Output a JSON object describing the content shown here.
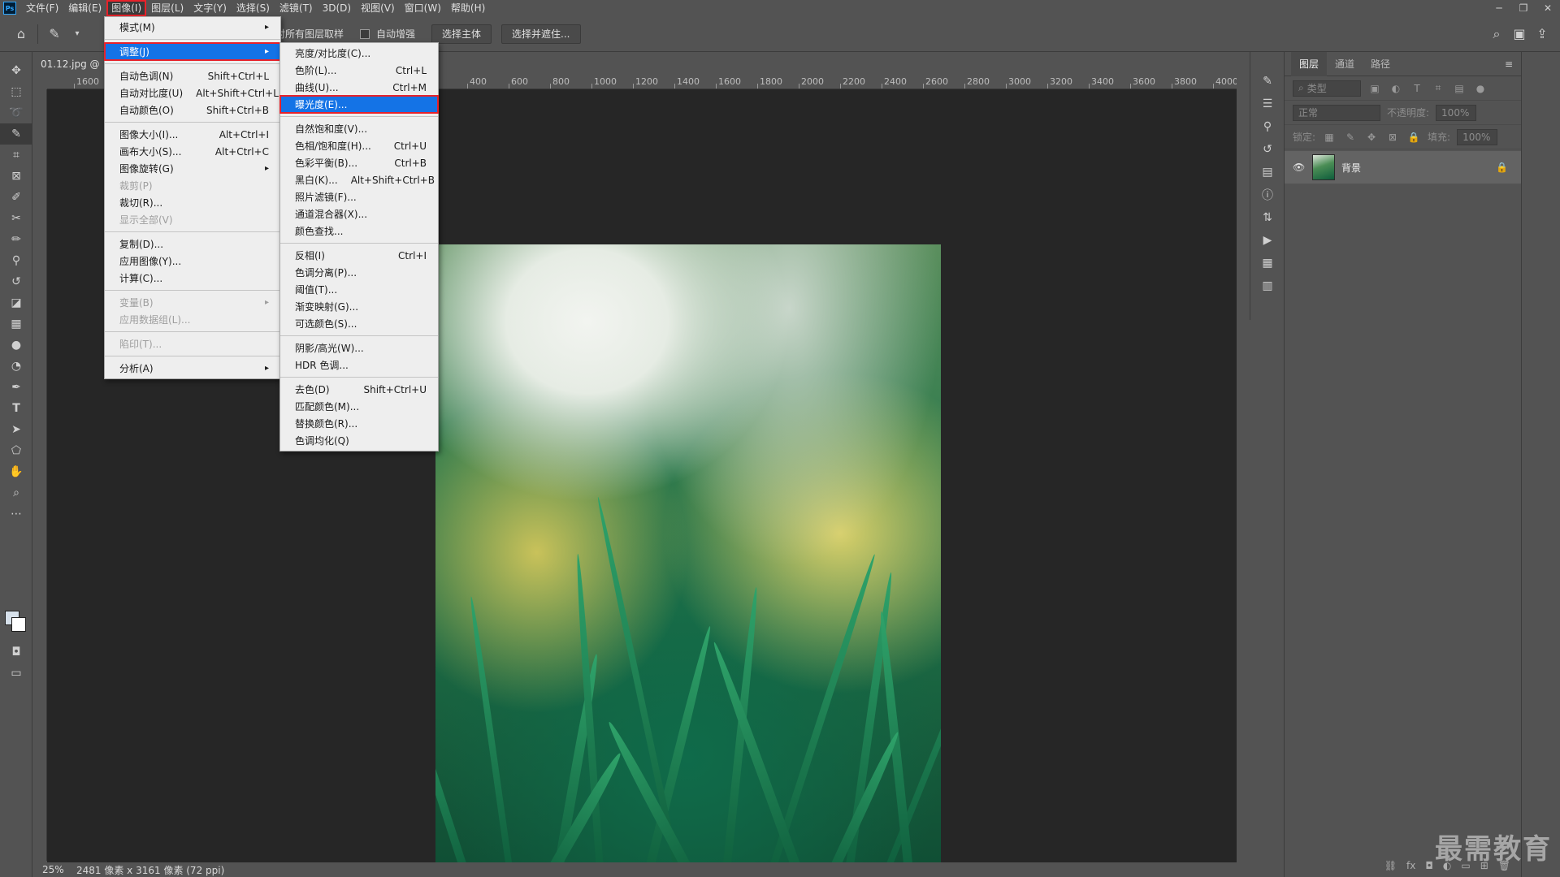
{
  "menubar": {
    "items": [
      "文件(F)",
      "编辑(E)",
      "图像(I)",
      "图层(L)",
      "文字(Y)",
      "选择(S)",
      "滤镜(T)",
      "3D(D)",
      "视图(V)",
      "窗口(W)",
      "帮助(H)"
    ],
    "active": "图像(I)",
    "logo": "Ps"
  },
  "options_bar": {
    "sample_all_layers": "对所有图层取样",
    "auto_enhance": "自动增强",
    "select_subject": "选择主体",
    "select_and_mask": "选择并遮住..."
  },
  "document": {
    "tab_title": "01.12.jpg @",
    "ruler_labels": [
      "1600",
      "400",
      "600",
      "800",
      "1000",
      "1200",
      "1400",
      "1600",
      "1800",
      "2000",
      "2200",
      "2400",
      "2600",
      "2800",
      "3000",
      "3200",
      "3400",
      "3600",
      "3800",
      "4000"
    ]
  },
  "status": {
    "zoom": "25%",
    "doc_info": "2481 像素 x 3161 像素 (72 ppi)"
  },
  "image_menu": [
    {
      "label": "模式(M)",
      "shortcut": "",
      "submenu": true,
      "disabled": false
    },
    {
      "sep": true
    },
    {
      "label": "调整(J)",
      "shortcut": "",
      "submenu": true,
      "disabled": false,
      "highlight": true
    },
    {
      "sep": true
    },
    {
      "label": "自动色调(N)",
      "shortcut": "Shift+Ctrl+L"
    },
    {
      "label": "自动对比度(U)",
      "shortcut": "Alt+Shift+Ctrl+L"
    },
    {
      "label": "自动颜色(O)",
      "shortcut": "Shift+Ctrl+B"
    },
    {
      "sep": true
    },
    {
      "label": "图像大小(I)...",
      "shortcut": "Alt+Ctrl+I"
    },
    {
      "label": "画布大小(S)...",
      "shortcut": "Alt+Ctrl+C"
    },
    {
      "label": "图像旋转(G)",
      "shortcut": "",
      "submenu": true
    },
    {
      "label": "裁剪(P)",
      "shortcut": "",
      "disabled": true
    },
    {
      "label": "裁切(R)...",
      "shortcut": ""
    },
    {
      "label": "显示全部(V)",
      "shortcut": "",
      "disabled": true
    },
    {
      "sep": true
    },
    {
      "label": "复制(D)...",
      "shortcut": ""
    },
    {
      "label": "应用图像(Y)...",
      "shortcut": ""
    },
    {
      "label": "计算(C)...",
      "shortcut": ""
    },
    {
      "sep": true
    },
    {
      "label": "变量(B)",
      "shortcut": "",
      "submenu": true,
      "disabled": true
    },
    {
      "label": "应用数据组(L)...",
      "shortcut": "",
      "disabled": true
    },
    {
      "sep": true
    },
    {
      "label": "陷印(T)...",
      "shortcut": "",
      "disabled": true
    },
    {
      "sep": true
    },
    {
      "label": "分析(A)",
      "shortcut": "",
      "submenu": true
    }
  ],
  "adjust_menu": [
    {
      "label": "亮度/对比度(C)...",
      "shortcut": ""
    },
    {
      "label": "色阶(L)...",
      "shortcut": "Ctrl+L"
    },
    {
      "label": "曲线(U)...",
      "shortcut": "Ctrl+M"
    },
    {
      "label": "曝光度(E)...",
      "shortcut": "",
      "highlight": true
    },
    {
      "sep": true
    },
    {
      "label": "自然饱和度(V)...",
      "shortcut": ""
    },
    {
      "label": "色相/饱和度(H)...",
      "shortcut": "Ctrl+U"
    },
    {
      "label": "色彩平衡(B)...",
      "shortcut": "Ctrl+B"
    },
    {
      "label": "黑白(K)...",
      "shortcut": "Alt+Shift+Ctrl+B"
    },
    {
      "label": "照片滤镜(F)...",
      "shortcut": ""
    },
    {
      "label": "通道混合器(X)...",
      "shortcut": ""
    },
    {
      "label": "颜色查找...",
      "shortcut": ""
    },
    {
      "sep": true
    },
    {
      "label": "反相(I)",
      "shortcut": "Ctrl+I"
    },
    {
      "label": "色调分离(P)...",
      "shortcut": ""
    },
    {
      "label": "阈值(T)...",
      "shortcut": ""
    },
    {
      "label": "渐变映射(G)...",
      "shortcut": ""
    },
    {
      "label": "可选颜色(S)...",
      "shortcut": ""
    },
    {
      "sep": true
    },
    {
      "label": "阴影/高光(W)...",
      "shortcut": ""
    },
    {
      "label": "HDR 色调...",
      "shortcut": ""
    },
    {
      "sep": true
    },
    {
      "label": "去色(D)",
      "shortcut": "Shift+Ctrl+U"
    },
    {
      "label": "匹配颜色(M)...",
      "shortcut": ""
    },
    {
      "label": "替换颜色(R)...",
      "shortcut": ""
    },
    {
      "label": "色调均化(Q)",
      "shortcut": ""
    }
  ],
  "layers_panel": {
    "tabs": [
      "图层",
      "通道",
      "路径"
    ],
    "active_tab": "图层",
    "filter_placeholder": "类型",
    "blend_mode": "正常",
    "opacity_label": "不透明度:",
    "opacity_value": "100%",
    "lock_label": "锁定:",
    "fill_label": "填充:",
    "fill_value": "100%",
    "layers": [
      {
        "name": "背景",
        "locked": true,
        "visible": true
      }
    ]
  },
  "watermark": "最需教育",
  "colors": {
    "accent": "#1473e6",
    "highlight_border": "#e8222a",
    "ui_bg": "#535353",
    "canvas_bg": "#262626"
  }
}
